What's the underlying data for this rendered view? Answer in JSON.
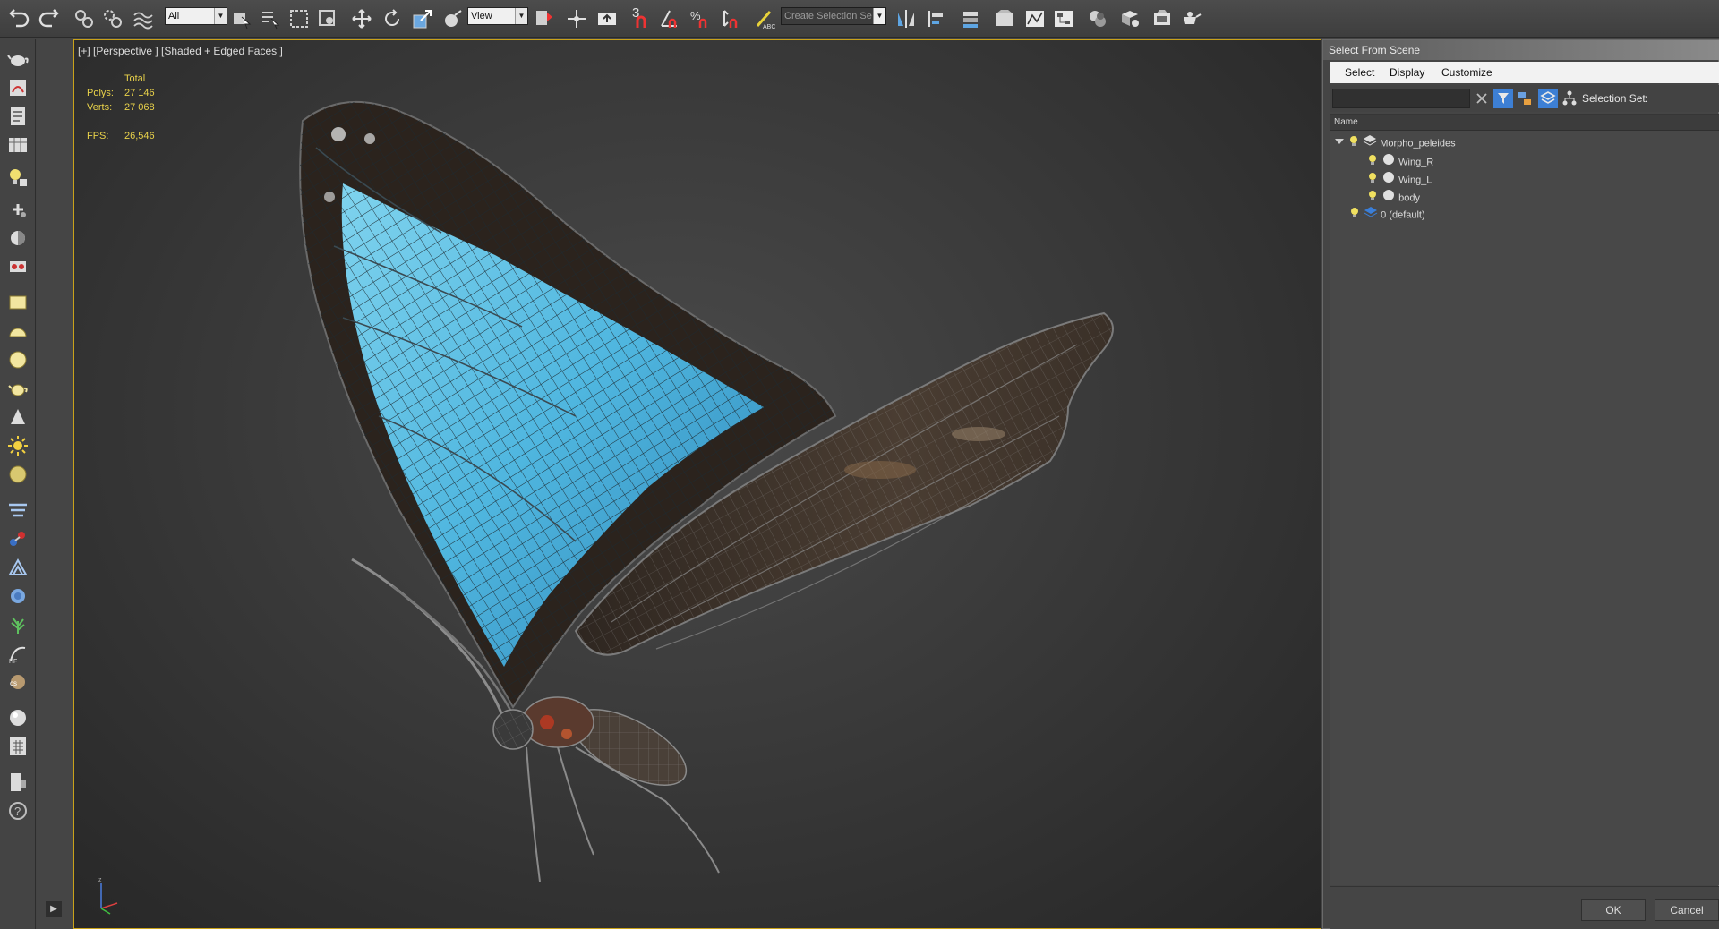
{
  "toolbar": {
    "filter_dropdown": "All",
    "reference_coord_dropdown": "View",
    "selection_set_dropdown": "Create Selection Se",
    "snap_3d_label": "3"
  },
  "viewport": {
    "label": "[+] [Perspective ] [Shaded + Edged Faces ]",
    "stats": {
      "header": "Total",
      "polys_label": "Polys:",
      "polys_value": "27 146",
      "verts_label": "Verts:",
      "verts_value": "27 068",
      "fps_label": "FPS:",
      "fps_value": "26,546"
    }
  },
  "dialog": {
    "title": "Select From Scene",
    "menu": [
      "Select",
      "Display",
      "Customize"
    ],
    "selection_set_label": "Selection Set:",
    "column_header": "Name",
    "tree": {
      "root": "Morpho_peleides",
      "children": [
        "Wing_R",
        "Wing_L",
        "body"
      ],
      "layer": "0 (default)"
    },
    "ok_label": "OK",
    "cancel_label": "Cancel"
  },
  "colors": {
    "viewport_border": "#c9a21a",
    "stats_text": "#e9d24a",
    "wing_blue": "#5fc8e6",
    "wing_dark": "#3b3129"
  }
}
